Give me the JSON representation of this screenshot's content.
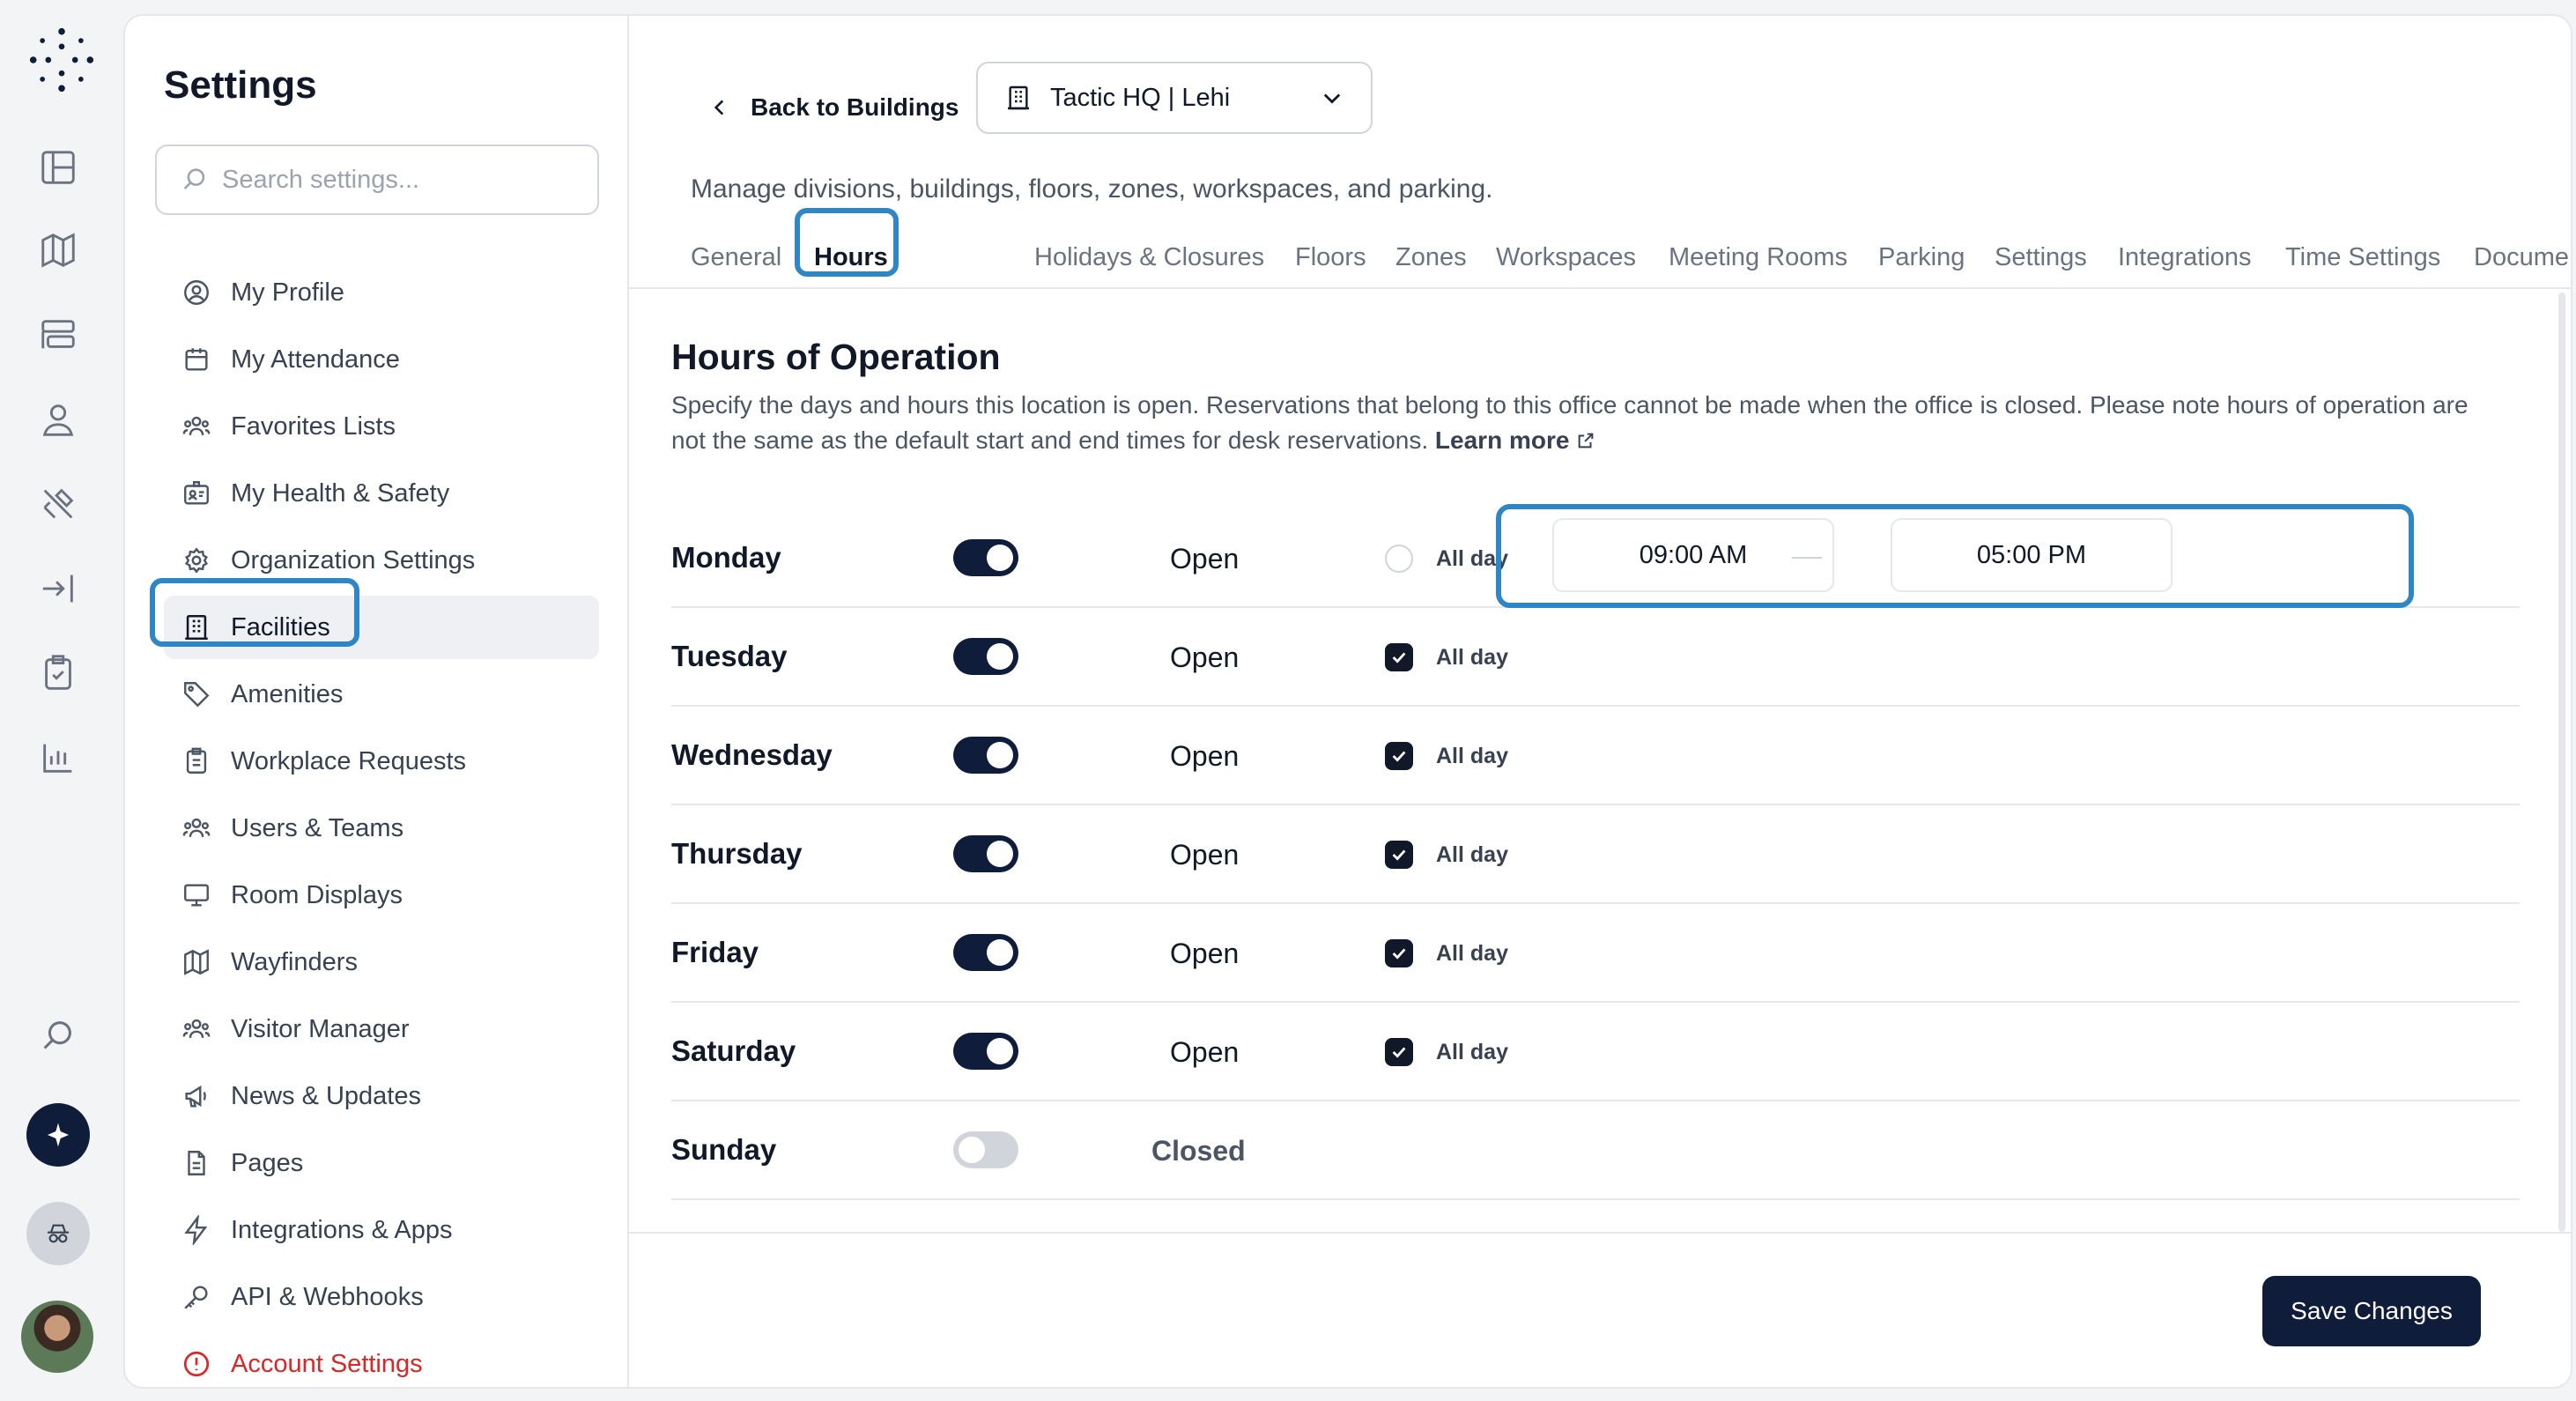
{
  "sidebar": {
    "title": "Settings",
    "search_placeholder": "Search settings...",
    "items": [
      {
        "label": "My Profile",
        "icon": "user-circle-icon"
      },
      {
        "label": "My Attendance",
        "icon": "calendar-icon"
      },
      {
        "label": "Favorites Lists",
        "icon": "users-group-icon"
      },
      {
        "label": "My Health & Safety",
        "icon": "id-badge-icon"
      },
      {
        "label": "Organization Settings",
        "icon": "gear-icon"
      },
      {
        "label": "Facilities",
        "icon": "building-icon"
      },
      {
        "label": "Amenities",
        "icon": "tag-icon"
      },
      {
        "label": "Workplace Requests",
        "icon": "clipboard-icon"
      },
      {
        "label": "Users & Teams",
        "icon": "users-group-icon"
      },
      {
        "label": "Room Displays",
        "icon": "monitor-icon"
      },
      {
        "label": "Wayfinders",
        "icon": "map-icon"
      },
      {
        "label": "Visitor Manager",
        "icon": "users-group-icon"
      },
      {
        "label": "News & Updates",
        "icon": "megaphone-icon"
      },
      {
        "label": "Pages",
        "icon": "document-icon"
      },
      {
        "label": "Integrations & Apps",
        "icon": "bolt-icon"
      },
      {
        "label": "API & Webhooks",
        "icon": "key-icon"
      },
      {
        "label": "Account Settings",
        "icon": "alert-circle-icon"
      }
    ]
  },
  "header": {
    "back_label": "Back to Buildings",
    "building": "Tactic HQ | Lehi",
    "subtitle": "Manage divisions, buildings, floors, zones, workspaces, and parking."
  },
  "tabs": [
    "General",
    "Hours",
    "Holidays & Closures",
    "Floors",
    "Zones",
    "Workspaces",
    "Meeting Rooms",
    "Parking",
    "Settings",
    "Integrations",
    "Time Settings",
    "Documents"
  ],
  "active_tab": "Hours",
  "hours": {
    "title": "Hours of Operation",
    "description": "Specify the days and hours this location is open. Reservations that belong to this office cannot be made when the office is closed. Please note hours of operation are not the same as the default start and end times for desk reservations.",
    "learn_more": "Learn more",
    "all_day_label": "All day",
    "days": [
      {
        "day": "Monday",
        "enabled": true,
        "status": "Open",
        "all_day": false,
        "start": "09:00 AM",
        "end": "05:00 PM"
      },
      {
        "day": "Tuesday",
        "enabled": true,
        "status": "Open",
        "all_day": true
      },
      {
        "day": "Wednesday",
        "enabled": true,
        "status": "Open",
        "all_day": true
      },
      {
        "day": "Thursday",
        "enabled": true,
        "status": "Open",
        "all_day": true
      },
      {
        "day": "Friday",
        "enabled": true,
        "status": "Open",
        "all_day": true
      },
      {
        "day": "Saturday",
        "enabled": true,
        "status": "Open",
        "all_day": true
      },
      {
        "day": "Sunday",
        "enabled": false,
        "status": "Closed",
        "all_day": false
      }
    ]
  },
  "footer": {
    "save_label": "Save Changes"
  },
  "colors": {
    "primary": "#0f1c3a",
    "highlight": "#2f86c4",
    "danger": "#dc2626"
  }
}
